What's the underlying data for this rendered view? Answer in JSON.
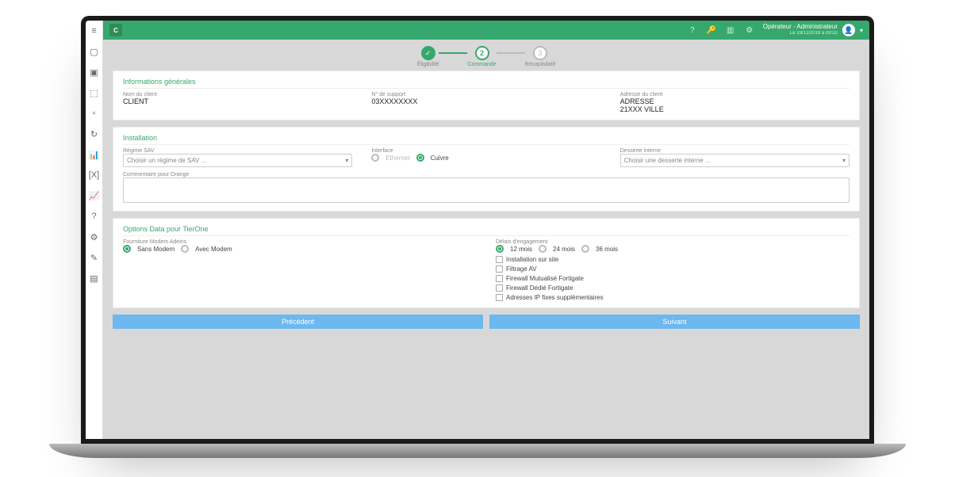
{
  "header": {
    "logo_text": "C",
    "user_name": "Opérateur - Administrateur",
    "user_timestamp": "Le 19/12/2019 à 09:32"
  },
  "stepper": {
    "step1": "Éligibilité",
    "step2": "Commande",
    "step3": "Récapitulatif"
  },
  "rail_icons": [
    "≡",
    "▢",
    "▣",
    "⬚",
    "▫",
    "↻",
    "📊",
    "[X]",
    "📈",
    "?",
    "⚙",
    "✎",
    "▤"
  ],
  "topbar_icons": [
    "?",
    "🔑",
    "▥",
    "⚙"
  ],
  "info": {
    "title": "Informations générales",
    "client_label": "Nom du client",
    "client_value": "CLIENT",
    "support_label": "N° de support",
    "support_value": "03XXXXXXXX",
    "address_label": "Adresse du client",
    "address_value": "ADRESSE\n21XXX VILLE"
  },
  "install": {
    "title": "Installation",
    "regime_label": "Régime SAV",
    "regime_placeholder": "Choisir un régime de SAV ...",
    "interface_label": "Interface",
    "interface_opt1": "Ethernet",
    "interface_opt2": "Cuivre",
    "desserte_label": "Desserte interne",
    "desserte_placeholder": "Choisir une desserte interne ...",
    "comment_label": "Commentaire pour Orange"
  },
  "options": {
    "title": "Options Data pour TierOne",
    "modem_label": "Fourniture Modem Adeins",
    "modem_opt1": "Sans Modem",
    "modem_opt2": "Avec Modem",
    "delai_label": "Délais d'engagement",
    "delai_opt1": "12 mois",
    "delai_opt2": "24 mois",
    "delai_opt3": "36 mois",
    "chk1": "Installation sur site",
    "chk2": "Filtrage AV",
    "chk3": "Firewall Mutualisé Fortigate",
    "chk4": "Firewall Dédié Fortigate",
    "chk5": "Adresses IP fixes supplémentaires"
  },
  "footer": {
    "prev": "Précédent",
    "next": "Suivant"
  }
}
